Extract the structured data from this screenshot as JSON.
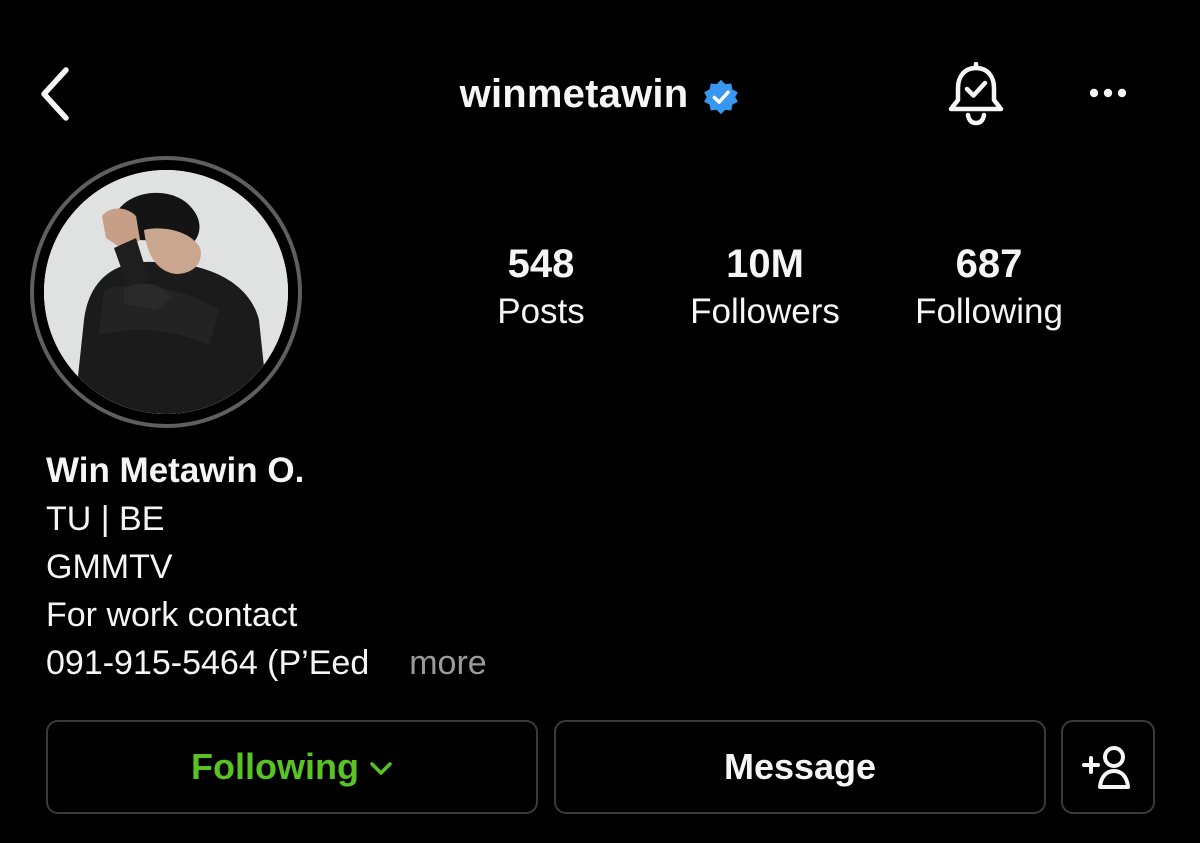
{
  "header": {
    "back_icon": "chevron-left-icon",
    "username": "winmetawin",
    "verified_icon": "verified-badge-icon",
    "verified_color": "#3897f0",
    "bell_icon": "bell-check-icon",
    "more_icon": "more-horizontal-icon"
  },
  "profile": {
    "avatar_icon": "profile-photo",
    "stats": [
      {
        "value": "548",
        "label": "Posts"
      },
      {
        "value": "10M",
        "label": "Followers"
      },
      {
        "value": "687",
        "label": "Following"
      }
    ],
    "name": "Win Metawin O.",
    "bio_lines": [
      "TU | BE",
      "GMMTV",
      "For work contact",
      "091-915-5464 (P’Eed"
    ],
    "more_label": "more"
  },
  "actions": {
    "following_label": "Following",
    "following_color": "#58c322",
    "message_label": "Message",
    "add_user_icon": "add-user-icon"
  }
}
